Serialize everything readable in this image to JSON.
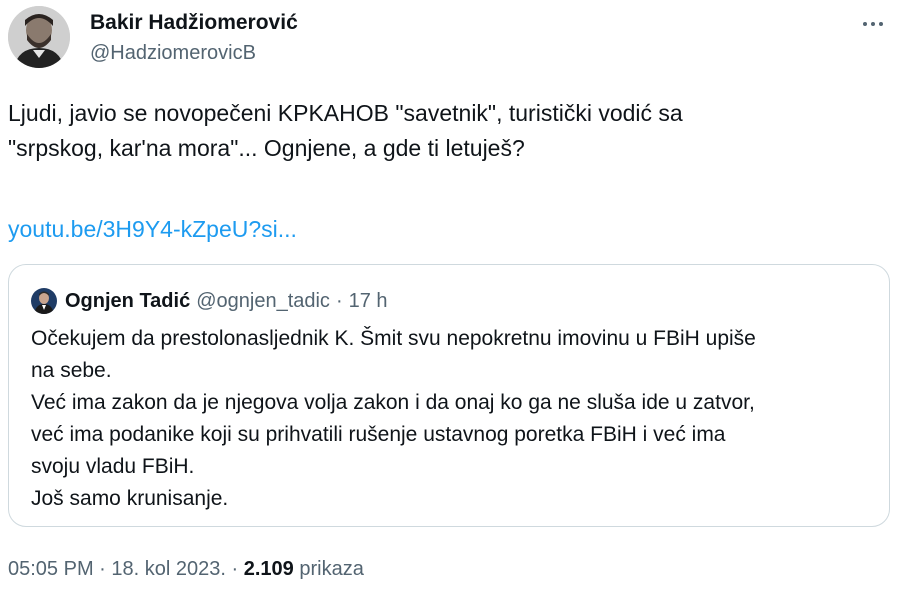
{
  "author": {
    "display_name": "Bakir Hadžiomerović",
    "handle": "@HadziomerovicB",
    "avatar_icon": "profile-photo"
  },
  "more_icon": "more-options-icon",
  "tweet": {
    "lines": [
      "Ljudi, javio se novopečeni KPKAHOB  \"savetnik\", turistički vodić sa",
      "\"srpskog, kar'na mora\"... Ognjene, a gde ti letuješ?"
    ],
    "link_text": "youtu.be/3H9Y4-kZpeU?si..."
  },
  "quoted_tweet": {
    "display_name": "Ognjen Tadić",
    "handle": "@ognjen_tadic",
    "separator": "·",
    "time": "17 h",
    "lines": [
      "Očekujem da prestolonasljednik K. Šmit svu nepokretnu imovinu u FBiH upiše",
      "na sebe.",
      "Već ima zakon da je njegova volja zakon i da onaj ko ga ne sluša ide u zatvor,",
      "već ima podanike koji su prihvatili rušenje ustavnog poretka FBiH i već ima",
      "svoju vladu FBiH.",
      "Još samo krunisanje."
    ]
  },
  "meta": {
    "time": "05:05 PM",
    "separator": "·",
    "date": "18. kol 2023.",
    "views_count": "2.109",
    "views_label": "prikaza"
  },
  "colors": {
    "text": "#0f1419",
    "secondary": "#536471",
    "link": "#1d9bf0",
    "border": "#cfd9de"
  }
}
